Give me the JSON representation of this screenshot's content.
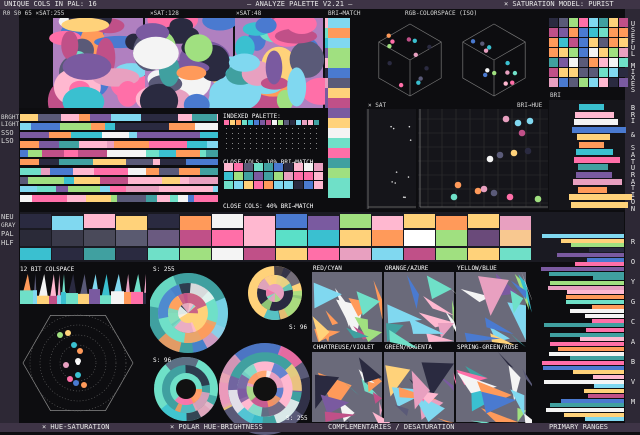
{
  "header": {
    "left": "UNIQUE COLS IN PAL: 16",
    "center": "– ANALYZE PALETTE V2.21 –",
    "right": "× SATURATION MODEL: PURIST"
  },
  "top_labels": {
    "r": "R0 S0 65 ×SAT:255",
    "sat128": "×SAT:128",
    "sat48": "×SAT:48",
    "brimatch": "BRI→MATCH",
    "rgb": "RGB-COLORSPACE (ISO)",
    "sat": "× SAT",
    "brihue": "BRI→HUE",
    "bri": "BRI"
  },
  "left_labels": {
    "bright": "BRGHT",
    "light": "LIGHT",
    "sso": "SSO",
    "lso": "LSO",
    "neu": "NEU",
    "gray": "GRAY",
    "pal": "PAL",
    "hlf": "HLF"
  },
  "indexed": {
    "title": "INDEXED PALETTE:",
    "close1": "CLOSE COLS: 10% BRI→MATCH",
    "close2": "CLOSE COLS: 40% BRI→MATCH"
  },
  "bottom_section": {
    "colspace": "12 BIT COLSPACE",
    "s255a": "S: 255",
    "s96a": "S: 96",
    "s96b": "S: 96",
    "s255b": "S: 255",
    "red_cyan": "RED/CYAN",
    "orange_azure": "ORANGE/AZURE",
    "yellow_blue": "YELLOW/BLUE",
    "chartreuse_violet": "CHARTREUSE/VIOLET",
    "green_magenta": "GREEN/MAGENTA",
    "spring_rose": "SPRING-GREEN/ROSE"
  },
  "footer": {
    "hue_sat": "× HUE-SATURATION",
    "polar": "× POLAR HUE-BRIGHTNESS",
    "complementaries": "COMPLEMENTARIES / DESATURATION",
    "primary": "PRIMARY RANGES"
  },
  "right_vertical": {
    "useful": [
      "U",
      "S",
      "E",
      "F",
      "U",
      "L",
      " ",
      "M",
      "I",
      "X",
      "E",
      "S"
    ],
    "brisat": [
      "B",
      "R",
      "I",
      " ",
      "&",
      " ",
      "S",
      "A",
      "T",
      "U",
      "R",
      "A",
      "T",
      "I",
      "O",
      "N"
    ],
    "roygbiv": [
      "R",
      "O",
      "Y",
      "G",
      "C",
      "A",
      "B",
      "V",
      "M"
    ]
  },
  "palette": [
    "#1a1c2c",
    "#5d275d",
    "#b13e53",
    "#ef7d57",
    "#ffcd75",
    "#a7f070",
    "#38b764",
    "#257179",
    "#29366f",
    "#3b5dc9",
    "#41a6f6",
    "#73eff7",
    "#f4f4f4",
    "#94b0c2",
    "#566c86",
    "#333c57"
  ],
  "mix_colors": [
    "#ff6fb0",
    "#f8f8f8",
    "#5ce0c8",
    "#ffd080",
    "#3a3a55",
    "#6a4a7a",
    "#c05080",
    "#80e0f0",
    "#ffa060",
    "#a0a0b0",
    "#e870a0",
    "#40c0a0"
  ]
}
